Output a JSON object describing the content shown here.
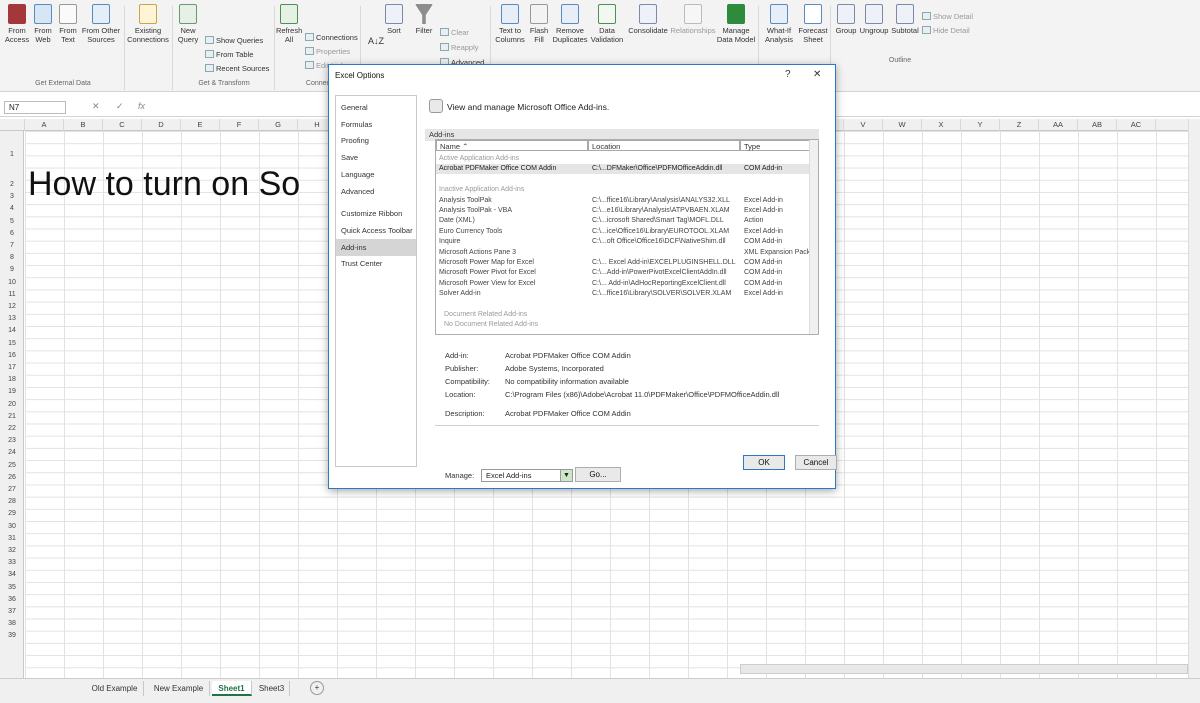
{
  "ribbon": {
    "from_access": "From\nAccess",
    "from_web": "From\nWeb",
    "from_text": "From\nText",
    "from_other": "From Other\nSources",
    "existing_conn": "Existing\nConnections",
    "new_query": "New\nQuery",
    "show_queries": "Show Queries",
    "from_table": "From Table",
    "recent_sources": "Recent Sources",
    "refresh_all": "Refresh\nAll",
    "connections": "Connections",
    "properties": "Properties",
    "edit_links": "Edit Links",
    "sort": "Sort",
    "filter": "Filter",
    "clear": "Clear",
    "reapply": "Reapply",
    "advanced": "Advanced",
    "text_to_columns": "Text to\nColumns",
    "flash_fill": "Flash\nFill",
    "remove_duplicates": "Remove\nDuplicates",
    "data_validation": "Data\nValidation",
    "consolidate": "Consolidate",
    "relationships": "Relationships",
    "manage_data_model": "Manage\nData Model",
    "what_if": "What-If\nAnalysis",
    "forecast_sheet": "Forecast\nSheet",
    "group": "Group",
    "ungroup": "Ungroup",
    "subtotal": "Subtotal",
    "show_detail": "Show Detail",
    "hide_detail": "Hide Detail",
    "grp_external": "Get External Data",
    "grp_transform": "Get & Transform",
    "grp_conn": "Connec",
    "grp_outline": "Outline"
  },
  "formula_bar": {
    "name_box": "N7",
    "fx": "fx"
  },
  "columns": [
    "A",
    "B",
    "C",
    "D",
    "E",
    "F",
    "G",
    "H",
    "",
    "",
    "",
    "",
    "",
    "",
    "",
    "",
    "",
    "",
    "",
    "",
    "",
    "V",
    "W",
    "X",
    "Y",
    "Z",
    "AA",
    "AB",
    "AC"
  ],
  "rows": [
    "1",
    "2",
    "3",
    "4",
    "5",
    "6",
    "7",
    "8",
    "9",
    "10",
    "11",
    "12",
    "13",
    "14",
    "15",
    "16",
    "17",
    "18",
    "19",
    "20",
    "21",
    "22",
    "23",
    "24",
    "25",
    "26",
    "27",
    "28",
    "29",
    "30",
    "31",
    "32",
    "33",
    "34",
    "35",
    "36",
    "37",
    "38",
    "39"
  ],
  "cell_text": "How to turn on So",
  "sheets": [
    "Old Example",
    "New Example",
    "Sheet1",
    "Sheet3"
  ],
  "active_sheet": "Sheet1",
  "add_sheet": "+",
  "dialog": {
    "title": "Excel Options",
    "help": "?",
    "close": "✕",
    "nav": [
      "General",
      "Formulas",
      "Proofing",
      "Save",
      "Language",
      "Advanced",
      "Customize Ribbon",
      "Quick Access Toolbar",
      "Add-ins",
      "Trust Center"
    ],
    "selected_nav": "Add-ins",
    "header": "View and manage Microsoft Office Add-ins.",
    "section": "Add-ins",
    "col_name": "Name ⌃",
    "col_location": "Location",
    "col_type": "Type",
    "rows": [
      {
        "name": "Active Application Add-ins",
        "loc": "",
        "type": "",
        "kind": "sec"
      },
      {
        "name": "Acrobat PDFMaker Office COM Addin",
        "loc": "C:\\...DFMaker\\Office\\PDFMOfficeAddin.dll",
        "type": "COM Add-in",
        "kind": "hl"
      },
      {
        "name": "",
        "loc": "",
        "type": "",
        "kind": "blank"
      },
      {
        "name": "Inactive Application Add-ins",
        "loc": "",
        "type": "",
        "kind": "sec"
      },
      {
        "name": "Analysis ToolPak",
        "loc": "C:\\...ffice16\\Library\\Analysis\\ANALYS32.XLL",
        "type": "Excel Add-in",
        "kind": ""
      },
      {
        "name": "Analysis ToolPak - VBA",
        "loc": "C:\\...e16\\Library\\Analysis\\ATPVBAEN.XLAM",
        "type": "Excel Add-in",
        "kind": ""
      },
      {
        "name": "Date (XML)",
        "loc": "C:\\...icrosoft Shared\\Smart Tag\\MOFL.DLL",
        "type": "Action",
        "kind": ""
      },
      {
        "name": "Euro Currency Tools",
        "loc": "C:\\...ice\\Office16\\Library\\EUROTOOL.XLAM",
        "type": "Excel Add-in",
        "kind": ""
      },
      {
        "name": "Inquire",
        "loc": "C:\\...oft Office\\Office16\\DCF\\NativeShim.dll",
        "type": "COM Add-in",
        "kind": ""
      },
      {
        "name": "Microsoft Actions Pane 3",
        "loc": "",
        "type": "XML Expansion Pack",
        "kind": ""
      },
      {
        "name": "Microsoft Power Map for Excel",
        "loc": "C:\\... Excel Add-in\\EXCELPLUGINSHELL.DLL",
        "type": "COM Add-in",
        "kind": ""
      },
      {
        "name": "Microsoft Power Pivot for Excel",
        "loc": "C:\\...Add-in\\PowerPivotExcelClientAddIn.dll",
        "type": "COM Add-in",
        "kind": ""
      },
      {
        "name": "Microsoft Power View for Excel",
        "loc": "C:\\... Add-in\\AdHocReportingExcelClient.dll",
        "type": "COM Add-in",
        "kind": ""
      },
      {
        "name": "Solver Add-in",
        "loc": "C:\\...ffice16\\Library\\SOLVER\\SOLVER.XLAM",
        "type": "Excel Add-in",
        "kind": ""
      },
      {
        "name": "",
        "loc": "",
        "type": "",
        "kind": "blank"
      },
      {
        "name": "Document Related Add-ins",
        "loc": "",
        "type": "",
        "kind": "sec"
      },
      {
        "name": "No Document Related Add-ins",
        "loc": "",
        "type": "",
        "kind": "sec"
      }
    ],
    "details": {
      "addin_label": "Add-in:",
      "addin": "Acrobat PDFMaker Office COM Addin",
      "publisher_label": "Publisher:",
      "publisher": "Adobe Systems, Incorporated",
      "compat_label": "Compatibility:",
      "compat": "No compatibility information available",
      "location_label": "Location:",
      "location": "C:\\Program Files (x86)\\Adobe\\Acrobat 11.0\\PDFMaker\\Office\\PDFMOfficeAddin.dll",
      "desc_label": "Description:",
      "desc": "Acrobat PDFMaker Office COM Addin"
    },
    "manage_label": "Manage:",
    "manage_value": "Excel Add-ins",
    "go": "Go...",
    "ok": "OK",
    "cancel": "Cancel"
  }
}
